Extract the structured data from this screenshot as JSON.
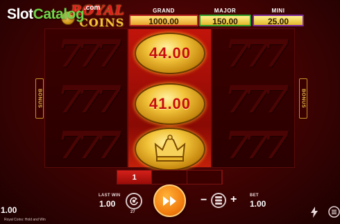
{
  "watermark": {
    "part1": "Slot",
    "part2": "Catalog",
    "suffix": ".com"
  },
  "logo": {
    "line1": "ROYAL",
    "line2": "COINS"
  },
  "jackpots": [
    {
      "label": "GRAND",
      "value": "1000.00"
    },
    {
      "label": "MAJOR",
      "value": "150.00"
    },
    {
      "label": "MINI",
      "value": "25.00"
    }
  ],
  "side_labels": {
    "left": "BONUS",
    "right": "BONUS"
  },
  "reels": {
    "symbol": "777",
    "coins": [
      {
        "value": "44.00"
      },
      {
        "value": "41.00"
      },
      {
        "icon": "crown-icon"
      }
    ]
  },
  "progress": {
    "cells": [
      "1",
      "",
      ""
    ],
    "active_index": 0
  },
  "controls": {
    "last_win_label": "LAST WIN",
    "last_win_value": "1.00",
    "autoplay_count": "27",
    "bet_label": "BET",
    "bet_value": "1.00",
    "minus": "−",
    "plus": "+"
  },
  "footer": {
    "balance": "1.00",
    "game_name": "Royal Coins: Hold and Win"
  },
  "colors": {
    "reel_red": "#c2140a",
    "grand_border": "#b22020",
    "major_border": "#2f9a2a",
    "mini_border": "#7a2a9a",
    "spin_orange": "#f27f10"
  }
}
